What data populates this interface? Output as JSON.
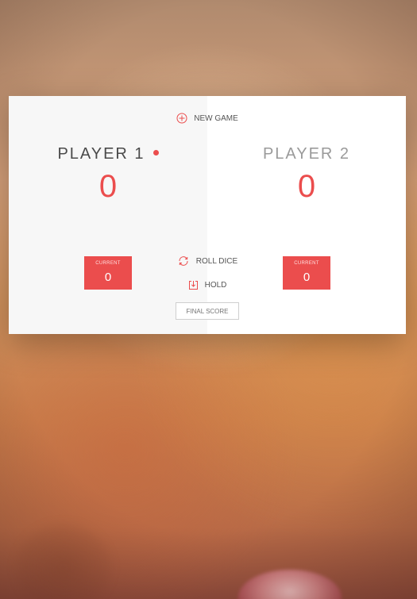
{
  "buttons": {
    "new_game": "New game",
    "roll_dice": "Roll dice",
    "hold": "Hold",
    "final_score_placeholder": "Final score"
  },
  "players": [
    {
      "name": "Player 1",
      "score": "0",
      "current_label": "Current",
      "current_score": "0",
      "active": true
    },
    {
      "name": "Player 2",
      "score": "0",
      "current_label": "Current",
      "current_score": "0",
      "active": false
    }
  ],
  "icons": {
    "new_game": "plus-circle-icon",
    "roll_dice": "refresh-icon",
    "hold": "download-icon",
    "active_player": "active-dot-icon"
  },
  "colors": {
    "accent": "#eb4d4d",
    "active_panel": "#f7f7f7",
    "inactive_panel": "#ffffff"
  }
}
